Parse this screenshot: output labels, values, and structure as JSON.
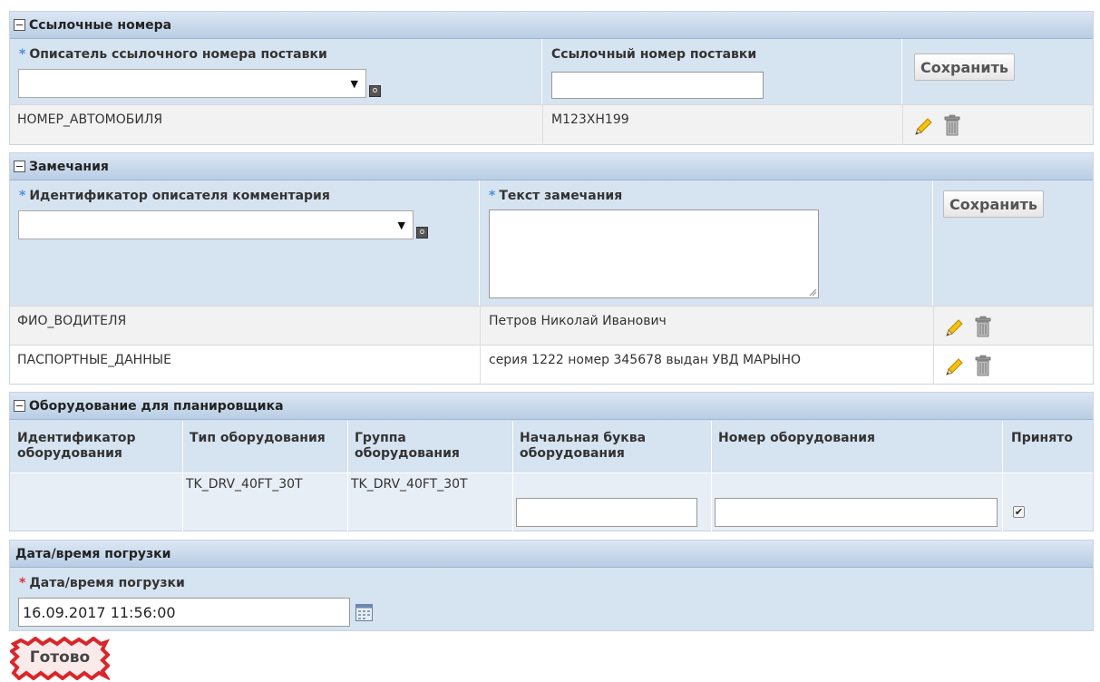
{
  "ref_section": {
    "title": "Ссылочные номера",
    "descriptor_label": "Описатель ссылочного номера поставки",
    "number_label": "Ссылочный номер поставки",
    "number_value": "",
    "save_label": "Сохранить",
    "rows": [
      {
        "descriptor": "НОМЕР_АВТОМОБИЛЯ",
        "value": "М123ХН199"
      }
    ]
  },
  "remarks_section": {
    "title": "Замечания",
    "descriptor_label": "Идентификатор описателя комментария",
    "text_label": "Текст замечания",
    "save_label": "Сохранить",
    "rows": [
      {
        "descriptor": "ФИО_ВОДИТЕЛЯ",
        "value": "Петров Николай Иванович"
      },
      {
        "descriptor": "ПАСПОРТНЫЕ_ДАННЫЕ",
        "value": "серия 1222 номер 345678 выдан УВД МАРЫНО"
      }
    ]
  },
  "equipment_section": {
    "title": "Оборудование для планировщика",
    "headers": {
      "id": "Идентификатор оборудования",
      "type": "Тип оборудования",
      "group": "Группа оборудования",
      "initial": "Начальная буква оборудования",
      "number": "Номер оборудования",
      "accepted": "Принято"
    },
    "row": {
      "id": "",
      "type": "TK_DRV_40FT_30T",
      "group": "TK_DRV_40FT_30T",
      "initial": "",
      "number": "",
      "accepted": true
    }
  },
  "loading_section": {
    "title": "Дата/время погрузки",
    "label": "Дата/время погрузки",
    "value": "16.09.2017 11:56:00"
  },
  "done_label": "Готово",
  "icons": {
    "collapse": "collapse-icon",
    "edit": "pencil-icon",
    "delete": "trash-icon",
    "lov": "lov-icon",
    "calendar": "calendar-icon"
  },
  "colors": {
    "header_gradient_top": "#dce7f3",
    "header_gradient_bottom": "#b8cde4",
    "form_bg": "#d6e3f0",
    "required_blue": "#4a90d9",
    "required_red": "#e03030",
    "done_red": "#d9262b"
  }
}
